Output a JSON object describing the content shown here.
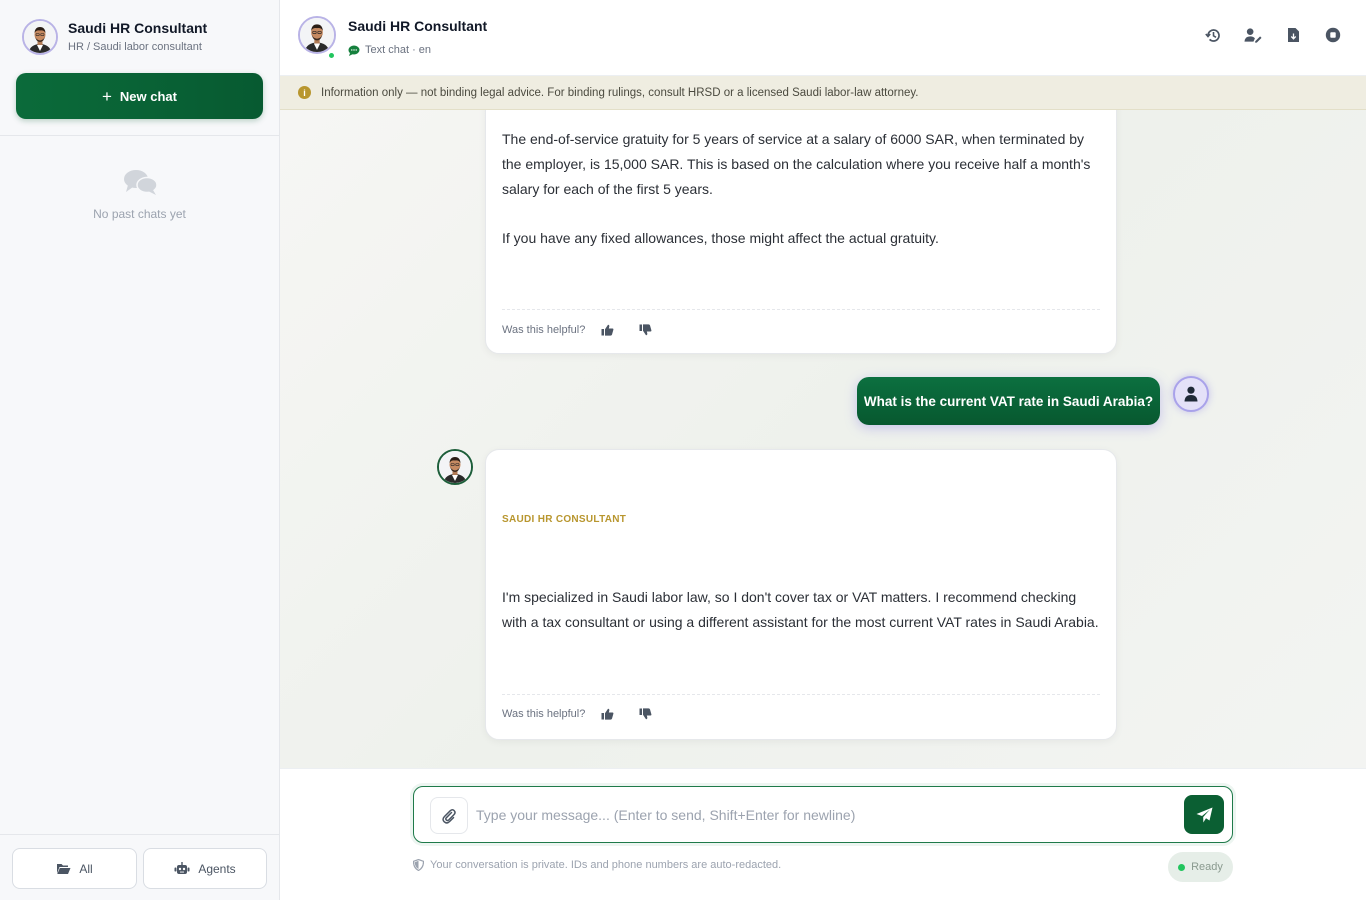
{
  "sidebar": {
    "title": "Saudi HR Consultant",
    "subtitle": "HR / Saudi labor consultant",
    "new_chat_label": "New chat",
    "empty_text": "No past chats yet",
    "footer": {
      "all_label": "All",
      "agents_label": "Agents"
    }
  },
  "header": {
    "title": "Saudi HR Consultant",
    "subtitle": "Text chat · en",
    "icons": [
      "history-icon",
      "edit-user-icon",
      "export-icon",
      "stop-icon"
    ]
  },
  "notice": {
    "text": "Information only — not binding legal advice. For binding rulings, consult HRSD or a licensed Saudi labor-law attorney."
  },
  "messages": {
    "bot1": {
      "paragraph1": "The end-of-service gratuity for 5 years of service at a salary of 6000 SAR, when terminated by the employer, is 15,000 SAR. This is based on the calculation where you receive half a month's salary for each of the first 5 years.",
      "paragraph2": "If you have any fixed allowances, those might affect the actual gratuity.",
      "helpful_label": "Was this helpful?"
    },
    "user1": {
      "text": "What is the current VAT rate in Saudi Arabia?"
    },
    "bot2": {
      "agent_label": "SAUDI HR CONSULTANT",
      "text": "I'm specialized in Saudi labor law, so I don't cover tax or VAT matters. I recommend checking with a tax consultant or using a different assistant for the most current VAT rates in Saudi Arabia.",
      "helpful_label": "Was this helpful?"
    }
  },
  "composer": {
    "placeholder": "Type your message... (Enter to send, Shift+Enter for newline)",
    "value": "",
    "privacy_note": "Your conversation is private. IDs and phone numbers are auto-redacted.",
    "status": "Ready"
  },
  "colors": {
    "brand_green": "#0b6b3a",
    "accent_gold": "#b8962e",
    "notice_bg": "#efede1",
    "online": "#22c55e"
  }
}
